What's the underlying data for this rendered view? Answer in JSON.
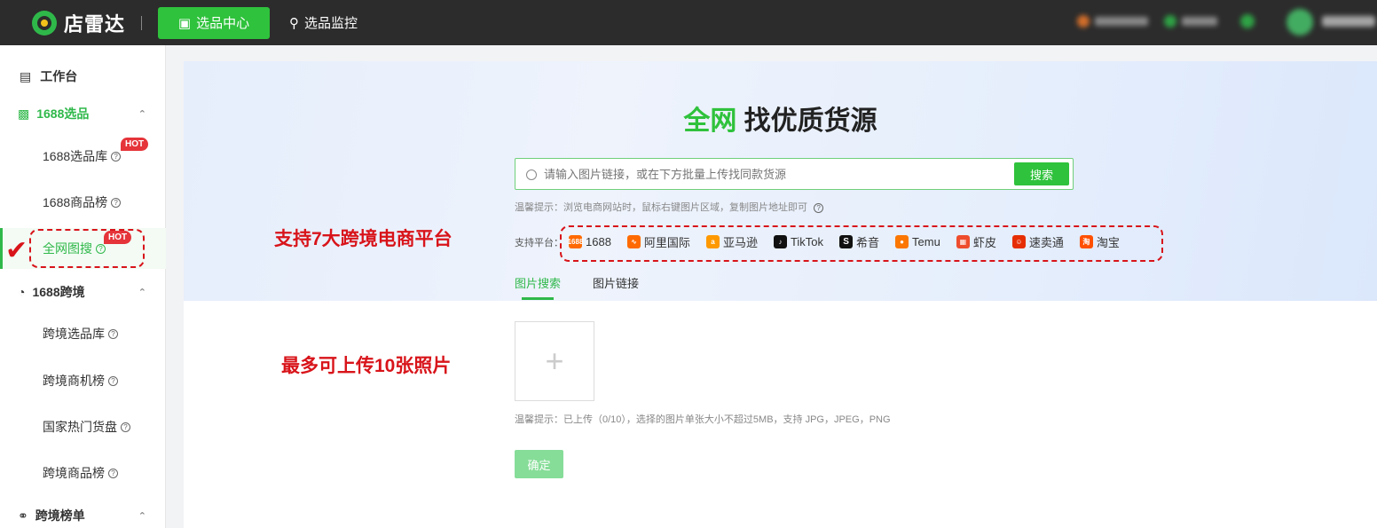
{
  "topbar": {
    "brand": "店雷达",
    "nav_active": "选品中心",
    "nav_monitor": "选品监控"
  },
  "sidebar": {
    "workbench": "工作台",
    "group_1688": "1688选品",
    "item_1688_library": "1688选品库",
    "item_1688_rank": "1688商品榜",
    "item_image_search": "全网图搜",
    "group_cross": "1688跨境",
    "item_cross_library": "跨境选品库",
    "item_cross_opportunity": "跨境商机榜",
    "item_country_hot": "国家热门货盘",
    "item_cross_rank": "跨境商品榜",
    "group_cross_list": "跨境榜单",
    "hot_badge": "HOT"
  },
  "hero": {
    "title_green": "全网",
    "title_rest": "找优质货源",
    "search_placeholder": "请输入图片链接，或在下方批量上传找同款货源",
    "search_button": "搜索",
    "tip": "温馨提示：浏览电商网站时，鼠标右键图片区域，复制图片地址即可",
    "platform_label": "支持平台：",
    "platforms": [
      {
        "name": "1688",
        "icon": "1688",
        "color": "#ff6a00"
      },
      {
        "name": "阿里国际",
        "icon": "alibaba",
        "color": "#ff6a00"
      },
      {
        "name": "亚马逊",
        "icon": "a",
        "color": "#ff9900"
      },
      {
        "name": "TikTok",
        "icon": "tiktok",
        "color": "#111111"
      },
      {
        "name": "希音",
        "icon": "S",
        "color": "#111111"
      },
      {
        "name": "Temu",
        "icon": "temu",
        "color": "#fb7701"
      },
      {
        "name": "虾皮",
        "icon": "shopee",
        "color": "#ee4d2d"
      },
      {
        "name": "速卖通",
        "icon": "aliexpress",
        "color": "#e62e04"
      },
      {
        "name": "淘宝",
        "icon": "淘",
        "color": "#ff5000"
      }
    ]
  },
  "tabs": {
    "image_search": "图片搜索",
    "image_link": "图片链接"
  },
  "upload": {
    "plus": "+",
    "tip": "温馨提示：已上传（0/10），选择的图片单张大小不超过5MB，支持 JPG，JPEG，PNG",
    "confirm": "确定"
  },
  "annotations": {
    "platforms_note": "支持7大跨境电商平台",
    "upload_note": "最多可上传10张照片"
  }
}
